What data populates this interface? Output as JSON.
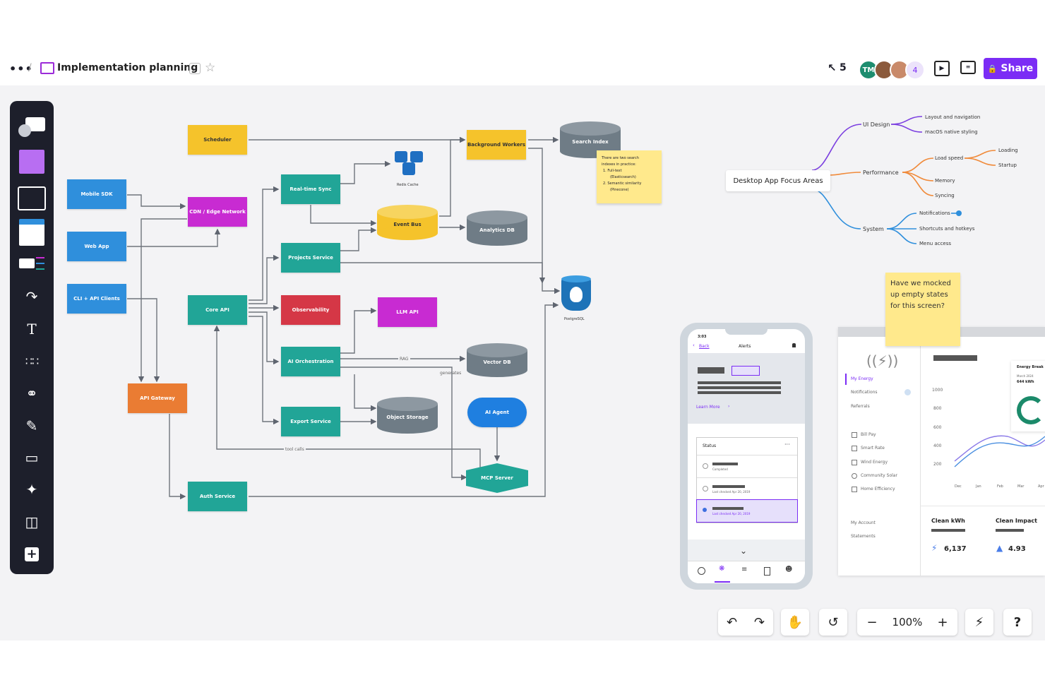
{
  "header": {
    "title": "Implementation planning",
    "pointer_count": "5",
    "avatar_initials": "TM",
    "extra_collaborators": "4",
    "share_label": "Share",
    "accent": "#7b2cf5"
  },
  "footer": {
    "zoom": "100%",
    "help": "?"
  },
  "diagram": {
    "scheduler": "Scheduler",
    "background_workers": "Background Workers",
    "search_index": "Search Index",
    "search_note": [
      "There are two search",
      "indexes in practice:",
      "1.  Full-text",
      "(Elasticsearch)",
      "2.  Semantic similarity",
      "(Pinecone)"
    ],
    "mobile_sdk": "Mobile SDK",
    "web_app": "Web App",
    "cli_clients": "CLI + API Clients",
    "cdn": "CDN / Edge Network",
    "realtime_sync": "Real-time Sync",
    "redis_cache": "Redis Cache",
    "event_bus": "Event Bus",
    "analytics_db": "Analytics DB",
    "projects_service": "Projects Service",
    "postgresql": "PostgreSQL",
    "core_api": "Core API",
    "observability": "Observability",
    "llm_api": "LLM API",
    "ai_orchestration": "AI Orchestration",
    "rag": "RAG",
    "vector_db": "Vector DB",
    "generates": "generates",
    "api_gateway": "API Gateway",
    "export_service": "Export Service",
    "object_storage": "Object Storage",
    "ai_agent": "AI Agent",
    "tool_calls": "tool calls",
    "mcp_server": "MCP Server",
    "auth_service": "Auth Service"
  },
  "mindmap": {
    "root": "Desktop App Focus Areas",
    "ui_design": "UI Design",
    "layout_nav": "Layout and navigation",
    "macos_styling": "macOS native styling",
    "performance": "Performance",
    "load_speed": "Load speed",
    "loading": "Loading",
    "startup": "Startup",
    "memory": "Memory",
    "syncing": "Syncing",
    "system": "System",
    "notifications": "Notifications",
    "shortcuts": "Shortcuts and hotkeys",
    "menu_access": "Menu access"
  },
  "sticky_note": {
    "text": "Have we mocked up empty states for this screen?"
  },
  "phone": {
    "time": "3:03",
    "back": "Back",
    "title": "Alerts",
    "learn_more": "Learn More",
    "status": "Status",
    "row1_sub": "Completed",
    "row2_sub": "Last checked Apr 20, 2019",
    "row3_sub": "Last checked Apr 20, 2019"
  },
  "dashboard": {
    "nav": [
      "My Energy",
      "Notifications",
      "Referrals"
    ],
    "tools": [
      "Bill Pay",
      "Smart Rate",
      "Wind Energy",
      "Community Solar",
      "Home Efficiency"
    ],
    "account": [
      "My Account",
      "Statements"
    ],
    "y_ticks": [
      "1000",
      "800",
      "600",
      "400",
      "200"
    ],
    "x_ticks": [
      "Dec",
      "Jan",
      "Feb",
      "Mar",
      "Apr"
    ],
    "card_title": "Energy Break",
    "card_date": "March 2024",
    "card_value": "644 kWh",
    "clean_kwh_label": "Clean kWh",
    "clean_kwh_value": "6,137",
    "clean_impact_label": "Clean Impact",
    "clean_impact_value": "4.93"
  }
}
